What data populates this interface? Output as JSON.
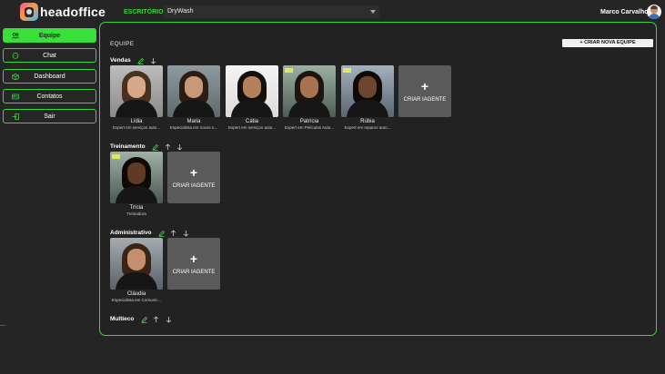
{
  "header": {
    "app_name": "headoffice",
    "office_label": "ESCRITÓRIO ›",
    "office_value": "DryWash",
    "user_name": "Marco Carvalho"
  },
  "sidebar": {
    "items": [
      {
        "label": "Equipe",
        "icon": "team-icon",
        "active": true
      },
      {
        "label": "Chat",
        "icon": "chat-icon",
        "active": false
      },
      {
        "label": "Dashboard",
        "icon": "dashboard-icon",
        "active": false
      },
      {
        "label": "Contatos",
        "icon": "contacts-icon",
        "active": false
      },
      {
        "label": "Sair",
        "icon": "logout-icon",
        "active": false
      }
    ]
  },
  "main": {
    "title": "EQUIPE",
    "new_team_label": "+ CRIAR NOVA EQUIPE",
    "create_agent_label": "CRIAR IAGENTE",
    "teams": [
      {
        "name": "Vendas",
        "agents": [
          {
            "name": "Lídia",
            "role": "Expert em serviços auto..."
          },
          {
            "name": "Maria",
            "role": "Especialista em novos n..."
          },
          {
            "name": "Cátia",
            "role": "Expert em serviços auto..."
          },
          {
            "name": "Patrícia",
            "role": "Expert em Películas Auto..."
          },
          {
            "name": "Rúbia",
            "role": "Expert em reparos auto..."
          }
        ]
      },
      {
        "name": "Treinamento",
        "agents": [
          {
            "name": "Trícia",
            "role": "Treinadora"
          }
        ]
      },
      {
        "name": "Administrativo",
        "agents": [
          {
            "name": "Cláudia",
            "role": "Especialista em Comunic..."
          }
        ]
      },
      {
        "name": "Multieco",
        "agents": []
      }
    ]
  },
  "colors": {
    "accent": "#39d83a",
    "background": "#252525",
    "card": "#5a5a5a"
  }
}
